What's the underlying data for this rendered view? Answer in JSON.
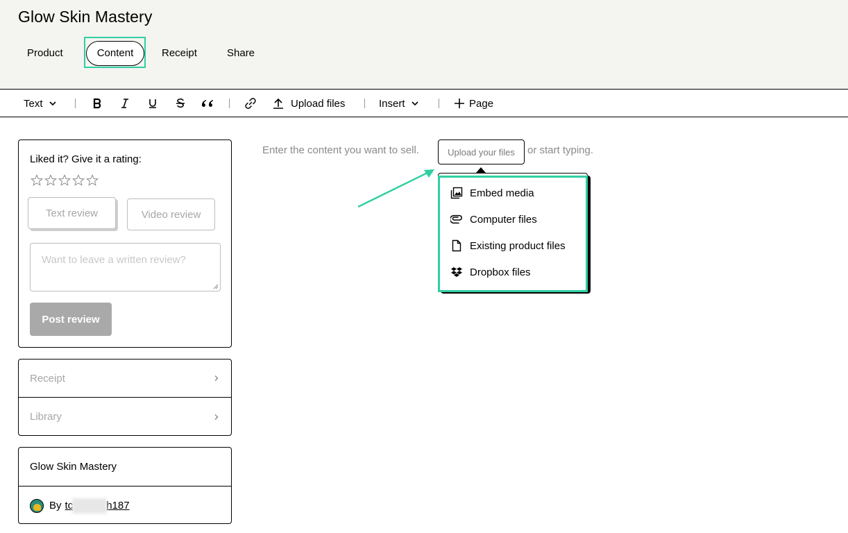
{
  "app": {
    "title": "Glow Skin Mastery"
  },
  "tabs": [
    {
      "label": "Product"
    },
    {
      "label": "Content",
      "active": true
    },
    {
      "label": "Receipt"
    },
    {
      "label": "Share"
    }
  ],
  "toolbar": {
    "text_style": "Text",
    "upload_label": "Upload files",
    "insert_label": "Insert",
    "page_label": "Page",
    "icons": [
      "chevron-down-icon",
      "bold-icon",
      "italic-icon",
      "underline-icon",
      "strikethrough-icon",
      "quote-icon",
      "link-icon",
      "upload-icon",
      "chevron-down-icon",
      "plus-icon"
    ]
  },
  "rating_card": {
    "title": "Liked it? Give it a rating:",
    "stars_total": 5,
    "stars_filled": 0,
    "text_review_label": "Text review",
    "video_review_label": "Video review",
    "review_placeholder": "Want to leave a written review?",
    "post_label": "Post review"
  },
  "nav": [
    {
      "label": "Receipt"
    },
    {
      "label": "Library"
    }
  ],
  "product_card": {
    "name": "Glow Skin Mastery",
    "by_label": "By",
    "author_prefix": "tc",
    "author_suffix": "h187"
  },
  "editor": {
    "prompt": "Enter the content you want to sell.",
    "upload_button": "Upload your files",
    "suffix": "or start typing."
  },
  "upload_menu": {
    "items": [
      {
        "label": "Embed media",
        "icon": "image-icon"
      },
      {
        "label": "Computer files",
        "icon": "paperclip-icon"
      },
      {
        "label": "Existing product files",
        "icon": "file-icon"
      },
      {
        "label": "Dropbox files",
        "icon": "dropbox-icon"
      }
    ]
  },
  "colors": {
    "highlight": "#2ecfa3",
    "header_bg": "#f4f4f0",
    "disabled_button": "#a9a9a9"
  }
}
